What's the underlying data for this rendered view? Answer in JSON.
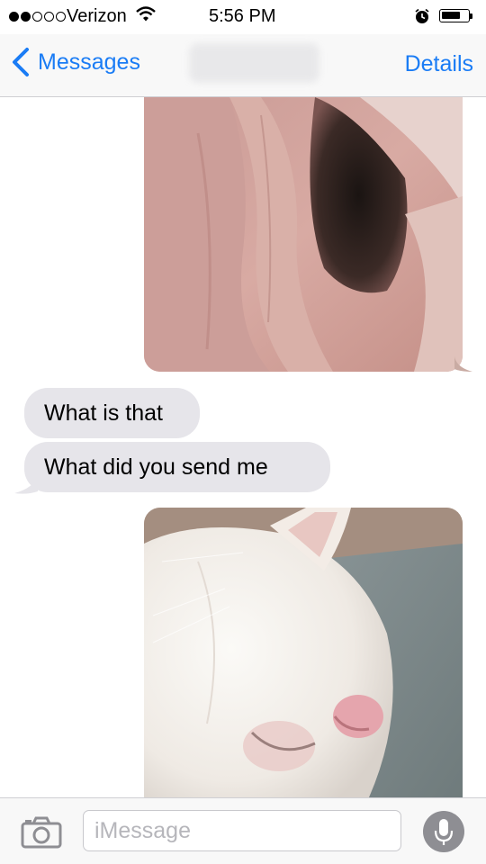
{
  "status_bar": {
    "signal_bars_filled": 2,
    "signal_bars_total": 5,
    "carrier": "Verizon",
    "time": "5:56 PM",
    "battery_level": 0.75,
    "icons": [
      "wifi-icon",
      "alarm-icon",
      "battery-icon"
    ]
  },
  "nav": {
    "back_label": "Messages",
    "details_label": "Details"
  },
  "messages": [
    {
      "type": "image",
      "direction": "outgoing",
      "content": "photo"
    },
    {
      "type": "text",
      "direction": "incoming",
      "text": "What is that"
    },
    {
      "type": "text",
      "direction": "incoming",
      "text": "What did you send me"
    },
    {
      "type": "image",
      "direction": "outgoing",
      "content": "photo"
    }
  ],
  "input_bar": {
    "placeholder": "iMessage",
    "value": ""
  },
  "colors": {
    "accent": "#1a7cf5",
    "incoming_bubble": "#e6e5ea",
    "bar_background": "#f8f8f8"
  }
}
